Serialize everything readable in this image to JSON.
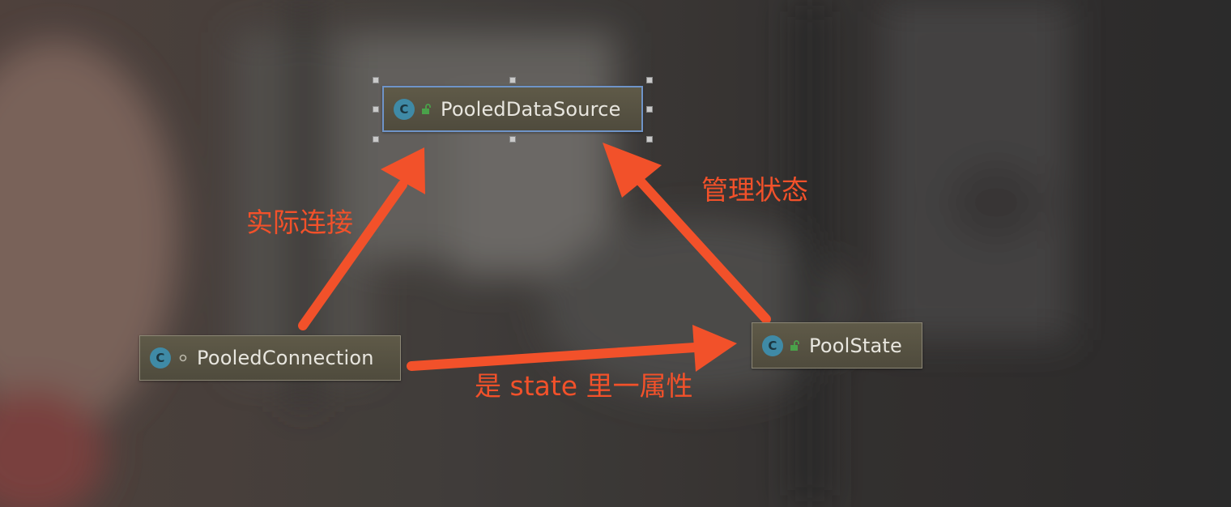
{
  "colors": {
    "arrow": "#f2512a",
    "label": "#f2512a",
    "class_badge": "#3f8aa6",
    "selection": "#6f94c8"
  },
  "nodes": [
    {
      "id": "pooled_data_source",
      "name": "PooledDataSource",
      "badge": "C",
      "visibility_icon": "open-lock-icon",
      "selected": true
    },
    {
      "id": "pooled_connection",
      "name": "PooledConnection",
      "badge": "C",
      "visibility_icon": "package-private-dot-icon",
      "selected": false
    },
    {
      "id": "pool_state",
      "name": "PoolState",
      "badge": "C",
      "visibility_icon": "open-lock-icon",
      "selected": false
    }
  ],
  "edges": [
    {
      "from": "pooled_connection",
      "to": "pooled_data_source",
      "label": "实际连接"
    },
    {
      "from": "pool_state",
      "to": "pooled_data_source",
      "label": "管理状态"
    },
    {
      "from": "pooled_connection",
      "to": "pool_state",
      "label": "是 state 里一属性"
    }
  ]
}
